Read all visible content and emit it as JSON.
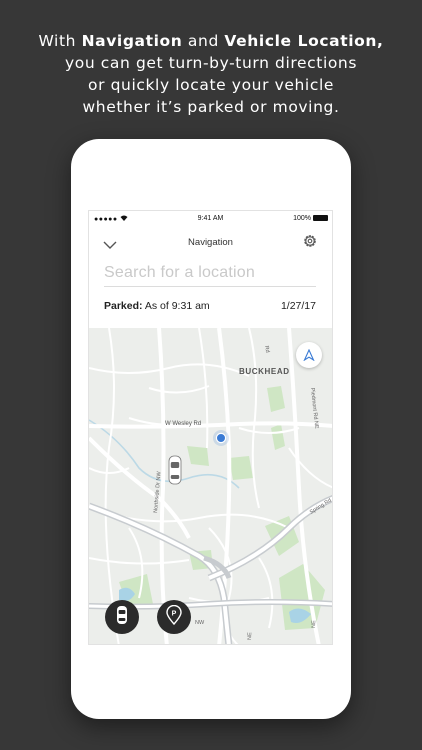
{
  "caption": {
    "line1_pre": "With ",
    "line1_b1": "Navigation",
    "line1_mid": " and ",
    "line1_b2": "Vehicle Location,",
    "line2": "you can get turn-by-turn directions",
    "line3": "or quickly locate your vehicle",
    "line4": "whether it’s parked or moving."
  },
  "status_bar": {
    "signal": "●●●●●",
    "time": "9:41 AM",
    "battery": "100%"
  },
  "navbar": {
    "title": "Navigation",
    "back_icon": "chevron-down-icon",
    "settings_icon": "gear-icon"
  },
  "search": {
    "placeholder": "Search for a location"
  },
  "parked": {
    "label": "Parked:",
    "time": "As of 9:31 am",
    "date": "1/27/17"
  },
  "map": {
    "labels": {
      "buckhead": "BUCKHEAD",
      "wesley": "W Wesley Rd",
      "northside": "Northside Dr NW",
      "piedmont": "Piedmont Rd NE",
      "springdale": "Spring Rd",
      "nw": "NW",
      "ne_a": "NE",
      "ne_b": "NE",
      "rd": "Rd"
    },
    "colors": {
      "land": "#eceeeb",
      "road": "#ffffff",
      "park": "#cfe6c4",
      "water": "#a9d3e6",
      "user_dot": "#3a7bd5"
    }
  },
  "buttons": {
    "car_icon": "car-icon",
    "parking_icon": "parking-pin-icon",
    "compass_icon": "navigation-arrow-icon"
  }
}
